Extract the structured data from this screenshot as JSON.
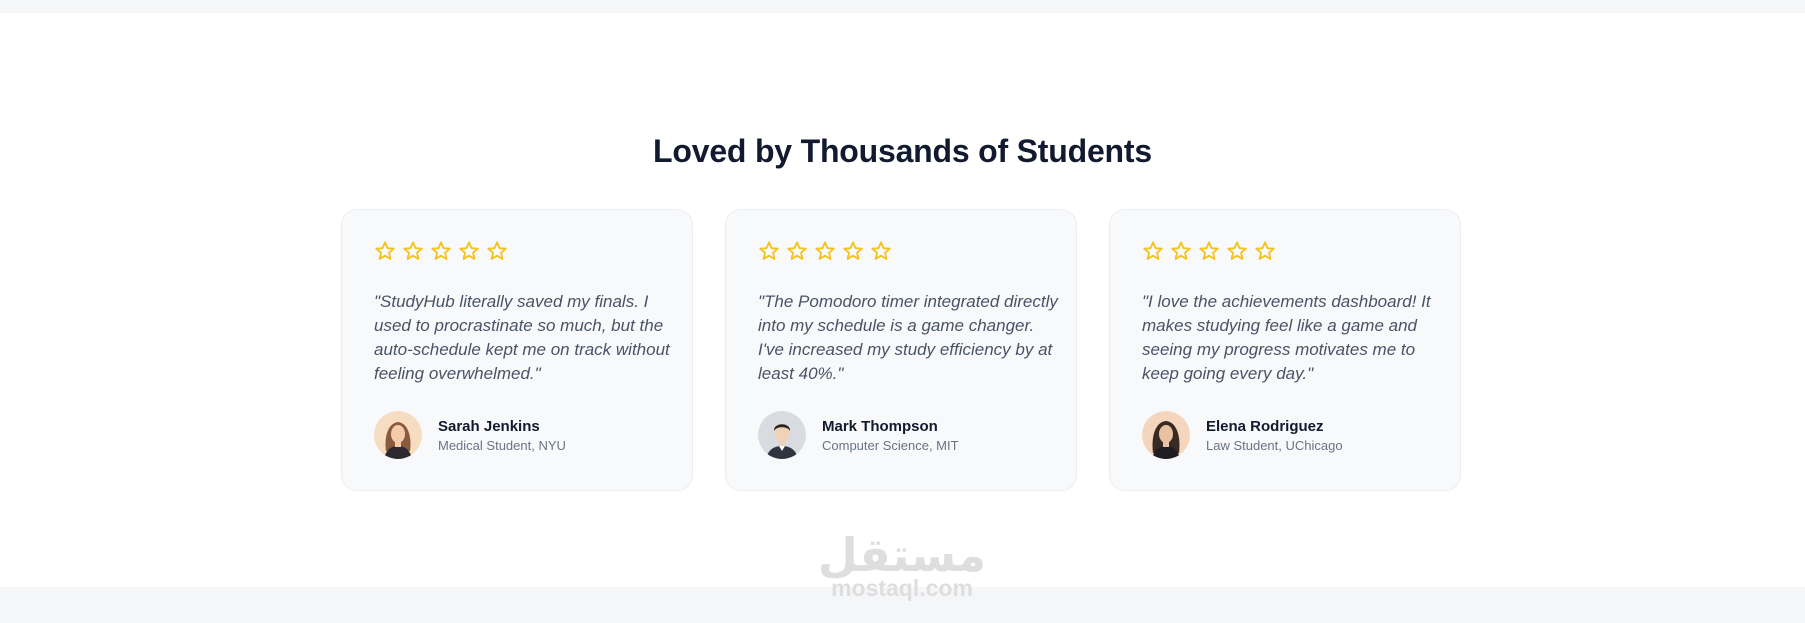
{
  "section": {
    "title": "Loved by Thousands of Students"
  },
  "colors": {
    "star": "#f5c21b",
    "heading": "#111a2e",
    "quote": "#4a5366",
    "card_background": "#f8f9fb"
  },
  "testimonials": [
    {
      "rating": 5,
      "quote": "\"StudyHub literally saved my finals. I used to procrastinate so much, but the auto-schedule kept me on track without feeling overwhelmed.\"",
      "name": "Sarah Jenkins",
      "role": "Medical Student, NYU",
      "avatar_icon": "avatar-woman-icon"
    },
    {
      "rating": 5,
      "quote": "\"The Pomodoro timer integrated directly into my schedule is a game changer. I've increased my study efficiency by at least 40%.\"",
      "name": "Mark Thompson",
      "role": "Computer Science, MIT",
      "avatar_icon": "avatar-man-icon"
    },
    {
      "rating": 5,
      "quote": "\"I love the achievements dashboard! It makes studying feel like a game and seeing my progress motivates me to keep going every day.\"",
      "name": "Elena Rodriguez",
      "role": "Law Student, UChicago",
      "avatar_icon": "avatar-woman-icon"
    }
  ],
  "watermark": {
    "arabic": "مستقل",
    "latin": "mostaql.com"
  }
}
